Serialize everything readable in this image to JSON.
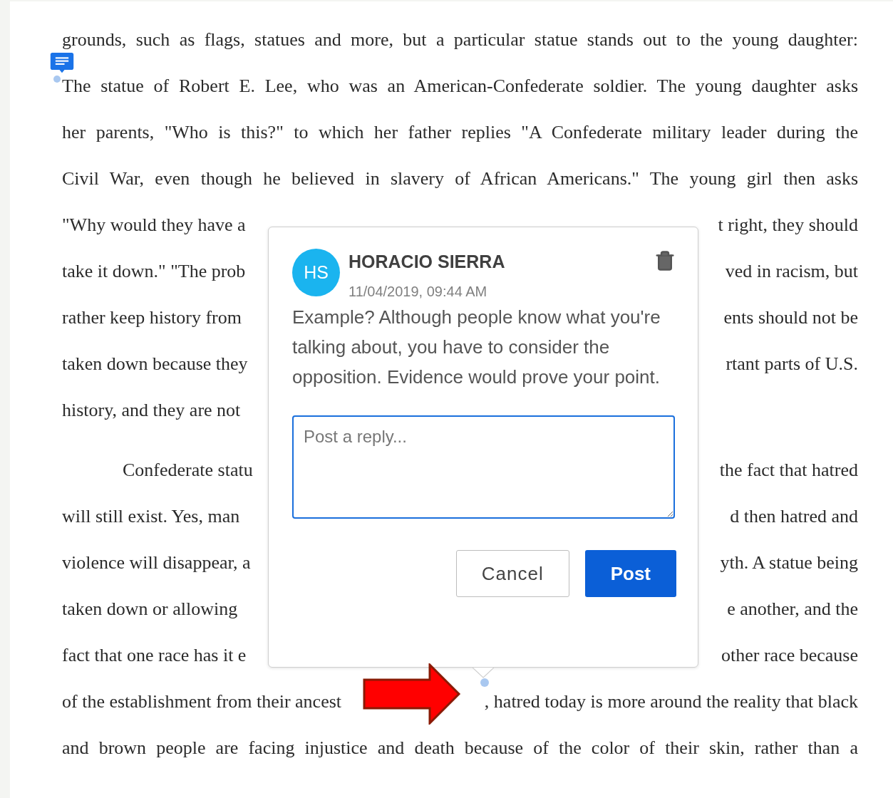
{
  "document": {
    "paragraphs": [
      {
        "first_line_indent": false,
        "lines": [
          {
            "kind": "full",
            "text": "grounds, such as flags, statues and more, but a particular statue stands out to the young daughter:"
          },
          {
            "kind": "full",
            "text": "The statue of Robert E. Lee, who was an American-Confederate soldier. The young daughter asks"
          },
          {
            "kind": "full",
            "text": "her parents, \"Who is this?\" to which her father replies \"A Confederate military leader during the"
          },
          {
            "kind": "full",
            "text": "Civil War, even though he believed in slavery of African Americans.\" The young girl then asks"
          },
          {
            "kind": "split",
            "left": "\"Why would they have a",
            "right": "t right, they should"
          },
          {
            "kind": "split",
            "left": "take it down.\" \"The prob",
            "right": "ved in racism, but"
          },
          {
            "kind": "split",
            "left": "rather keep history from",
            "right": "ents should not be"
          },
          {
            "kind": "split",
            "left": "taken down because they",
            "right": "rtant parts of U.S."
          },
          {
            "kind": "split",
            "left": "history, and they are not"
          }
        ]
      },
      {
        "first_line_indent": true,
        "lines": [
          {
            "kind": "split",
            "left": "Confederate statu",
            "right": "the fact that hatred"
          },
          {
            "kind": "split",
            "left": "will still exist. Yes, man",
            "right": "d then hatred and"
          },
          {
            "kind": "split",
            "left": "violence will disappear, a",
            "right": "yth. A statue being"
          },
          {
            "kind": "split",
            "left": "taken down or allowing",
            "right": "e another, and the"
          },
          {
            "kind": "split",
            "left": "fact that one race has it e",
            "right": "other race because"
          },
          {
            "kind": "split",
            "left": "of the establishment from their ancest",
            "right": ", hatred today is more around the reality that black"
          },
          {
            "kind": "full",
            "text": "and brown people are facing injustice and death because of the color of their skin, rather than a"
          }
        ]
      }
    ]
  },
  "comment_popup": {
    "comment": {
      "avatar_initials": "HS",
      "author": "HORACIO SIERRA",
      "timestamp": "11/04/2019, 09:44 AM",
      "text": "Example? Although people know what you're talking about, you have to consider the opposition. Evidence would prove your point."
    },
    "reply": {
      "placeholder": "Post a reply..."
    },
    "buttons": [
      {
        "label": "Cancel",
        "kind": "secondary"
      },
      {
        "label": "Post",
        "kind": "primary"
      }
    ]
  }
}
